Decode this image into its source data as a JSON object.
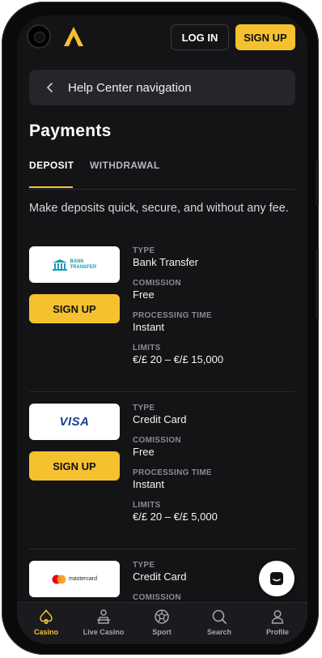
{
  "header": {
    "login_label": "LOG IN",
    "signup_label": "SIGN UP",
    "brand_color": "#f5c12e"
  },
  "help_nav": {
    "label": "Help Center navigation"
  },
  "page": {
    "title": "Payments",
    "tabs": [
      {
        "label": "DEPOSIT",
        "active": true
      },
      {
        "label": "WITHDRAWAL",
        "active": false
      }
    ],
    "intro": "Make deposits quick, secure, and without any fee."
  },
  "field_labels": {
    "type": "TYPE",
    "commission": "COMISSION",
    "processing": "PROCESSING TIME",
    "limits": "LIMITS"
  },
  "methods": [
    {
      "logo_text": "BANK TRANSFER",
      "logo_icon": "bank-icon",
      "signup_label": "SIGN UP",
      "type": "Bank Transfer",
      "commission": "Free",
      "processing": "Instant",
      "limits": "€/£ 20 – €/£ 15,000"
    },
    {
      "logo_text": "VISA",
      "logo_icon": "visa-logo",
      "signup_label": "SIGN UP",
      "type": "Credit Card",
      "commission": "Free",
      "processing": "Instant",
      "limits": "€/£ 20 – €/£ 5,000"
    },
    {
      "logo_text": "mastercard",
      "logo_icon": "mastercard-logo",
      "type": "Credit Card"
    }
  ],
  "bottom_nav": [
    {
      "label": "Casino",
      "icon": "spade-icon",
      "active": true
    },
    {
      "label": "Live Casino",
      "icon": "dealer-icon",
      "active": false
    },
    {
      "label": "Sport",
      "icon": "ball-icon",
      "active": false
    },
    {
      "label": "Search",
      "icon": "search-icon",
      "active": false
    },
    {
      "label": "Profile",
      "icon": "profile-icon",
      "active": false
    }
  ]
}
